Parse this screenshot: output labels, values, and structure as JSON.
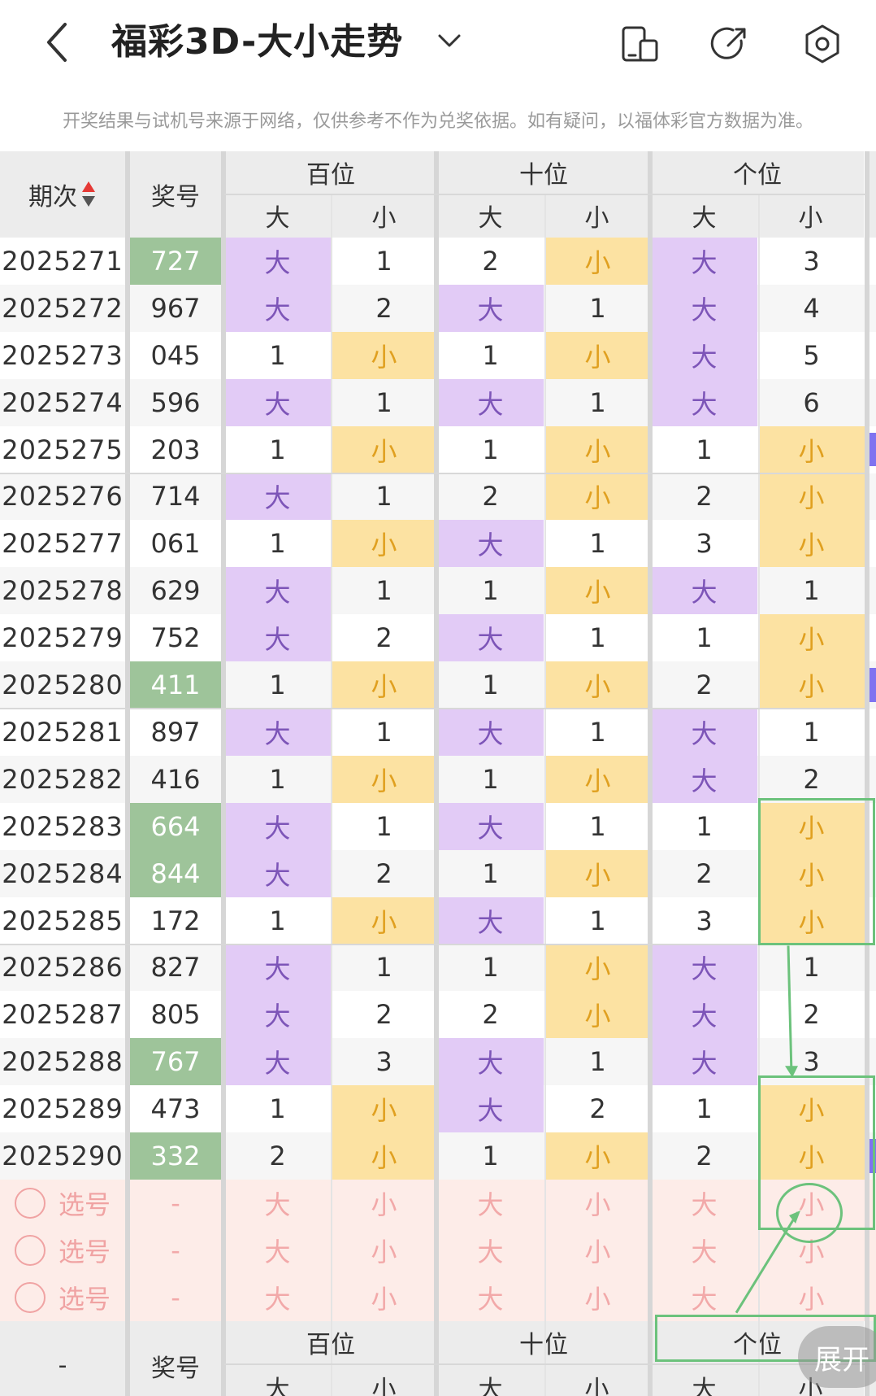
{
  "header": {
    "title": "福彩3D-大小走势",
    "notice": "开奖结果与试机号来源于网络，仅供参考不作为兑奖依据。如有疑问，以福体彩官方数据为准。"
  },
  "table_header": {
    "period": "期次",
    "number": "奖号",
    "groups": [
      "百位",
      "十位",
      "个位"
    ],
    "big": "大",
    "small": "小"
  },
  "rows": [
    {
      "period": "2025271",
      "number": "727",
      "highlight": true,
      "cells": [
        "大",
        "1",
        "2",
        "小",
        "大",
        "3"
      ]
    },
    {
      "period": "2025272",
      "number": "967",
      "highlight": false,
      "cells": [
        "大",
        "2",
        "大",
        "1",
        "大",
        "4"
      ]
    },
    {
      "period": "2025273",
      "number": "045",
      "highlight": false,
      "cells": [
        "1",
        "小",
        "1",
        "小",
        "大",
        "5"
      ]
    },
    {
      "period": "2025274",
      "number": "596",
      "highlight": false,
      "cells": [
        "大",
        "1",
        "大",
        "1",
        "大",
        "6"
      ]
    },
    {
      "period": "2025275",
      "number": "203",
      "highlight": false,
      "cells": [
        "1",
        "小",
        "1",
        "小",
        "1",
        "小"
      ]
    },
    {
      "period": "2025276",
      "number": "714",
      "highlight": false,
      "cells": [
        "大",
        "1",
        "2",
        "小",
        "2",
        "小"
      ]
    },
    {
      "period": "2025277",
      "number": "061",
      "highlight": false,
      "cells": [
        "1",
        "小",
        "大",
        "1",
        "3",
        "小"
      ]
    },
    {
      "period": "2025278",
      "number": "629",
      "highlight": false,
      "cells": [
        "大",
        "1",
        "1",
        "小",
        "大",
        "1"
      ]
    },
    {
      "period": "2025279",
      "number": "752",
      "highlight": false,
      "cells": [
        "大",
        "2",
        "大",
        "1",
        "1",
        "小"
      ]
    },
    {
      "period": "2025280",
      "number": "411",
      "highlight": true,
      "cells": [
        "1",
        "小",
        "1",
        "小",
        "2",
        "小"
      ]
    },
    {
      "period": "2025281",
      "number": "897",
      "highlight": false,
      "cells": [
        "大",
        "1",
        "大",
        "1",
        "大",
        "1"
      ]
    },
    {
      "period": "2025282",
      "number": "416",
      "highlight": false,
      "cells": [
        "1",
        "小",
        "1",
        "小",
        "大",
        "2"
      ]
    },
    {
      "period": "2025283",
      "number": "664",
      "highlight": true,
      "cells": [
        "大",
        "1",
        "大",
        "1",
        "1",
        "小"
      ]
    },
    {
      "period": "2025284",
      "number": "844",
      "highlight": true,
      "cells": [
        "大",
        "2",
        "1",
        "小",
        "2",
        "小"
      ]
    },
    {
      "period": "2025285",
      "number": "172",
      "highlight": false,
      "cells": [
        "1",
        "小",
        "大",
        "1",
        "3",
        "小"
      ]
    },
    {
      "period": "2025286",
      "number": "827",
      "highlight": false,
      "cells": [
        "大",
        "1",
        "1",
        "小",
        "大",
        "1"
      ]
    },
    {
      "period": "2025287",
      "number": "805",
      "highlight": false,
      "cells": [
        "大",
        "2",
        "2",
        "小",
        "大",
        "2"
      ]
    },
    {
      "period": "2025288",
      "number": "767",
      "highlight": true,
      "cells": [
        "大",
        "3",
        "大",
        "1",
        "大",
        "3"
      ]
    },
    {
      "period": "2025289",
      "number": "473",
      "highlight": false,
      "cells": [
        "1",
        "小",
        "大",
        "2",
        "1",
        "小"
      ]
    },
    {
      "period": "2025290",
      "number": "332",
      "highlight": true,
      "cells": [
        "2",
        "小",
        "1",
        "小",
        "2",
        "小"
      ]
    }
  ],
  "select_rows": [
    {
      "label": "选号",
      "number": "-",
      "cells": [
        "大",
        "小",
        "大",
        "小",
        "大",
        "小"
      ]
    },
    {
      "label": "选号",
      "number": "-",
      "cells": [
        "大",
        "小",
        "大",
        "小",
        "大",
        "小"
      ]
    },
    {
      "label": "选号",
      "number": "-",
      "cells": [
        "大",
        "小",
        "大",
        "小",
        "大",
        "小"
      ]
    }
  ],
  "footer": {
    "period": "-",
    "number": "奖号",
    "groups": [
      "百位",
      "十位",
      "个位"
    ],
    "big": "大",
    "small": "小",
    "expand": "展开"
  },
  "colors": {
    "big_text": "#7d55b8",
    "small_text": "#e0a020",
    "big_bg": "#e2cbf6",
    "small_bg": "#fce2a2",
    "highlight_number_bg": "#9ec49a",
    "annotation": "#6cc27c",
    "side_indicator": "#7f73f0"
  }
}
